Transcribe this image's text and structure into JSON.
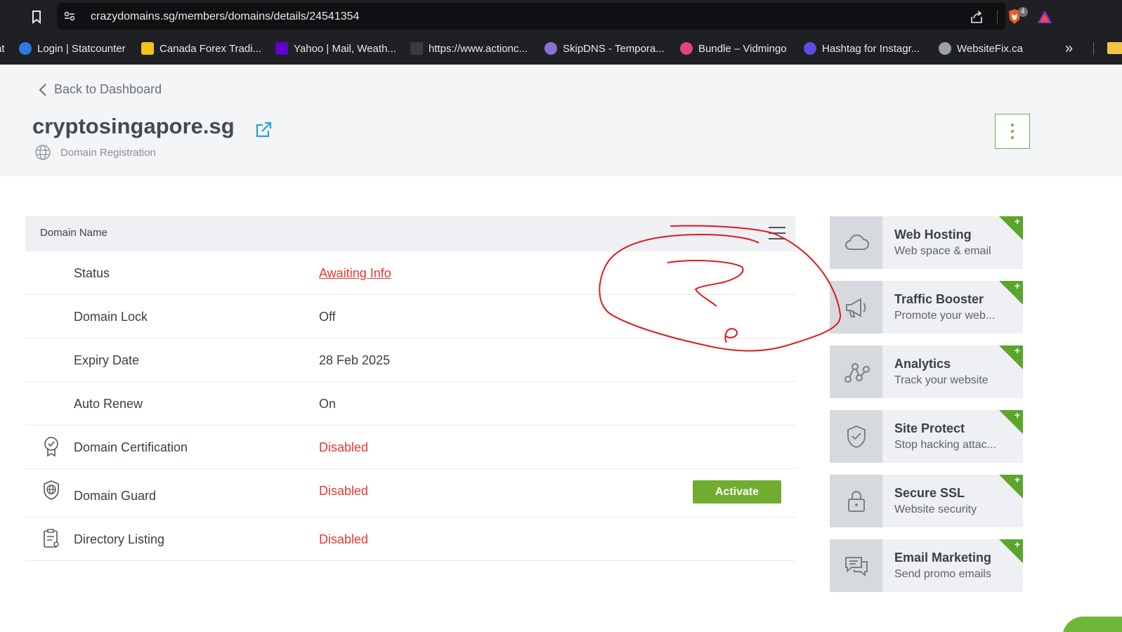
{
  "browser": {
    "url": "crazydomains.sg/members/domains/details/24541354",
    "extension_badge": "4",
    "bookmarks": [
      {
        "label": "Login | Statcounter",
        "icon": "statcounter-icon",
        "color": "#2a7ae2"
      },
      {
        "label": "Canada Forex Tradi...",
        "icon": "maple-leaf-icon",
        "color": "#f0c419"
      },
      {
        "label": "Yahoo | Mail, Weath...",
        "icon": "yahoo-icon",
        "color": "#5f01d1"
      },
      {
        "label": "https://www.actionc...",
        "icon": "page-icon",
        "color": "#3a3b3e"
      },
      {
        "label": "SkipDNS - Tempora...",
        "icon": "skipdns-icon",
        "color": "#8b6fd6"
      },
      {
        "label": "Bundle – Vidmingo",
        "icon": "bundle-icon",
        "color": "#e0457b"
      },
      {
        "label": "Hashtag for Instagr...",
        "icon": "hashtag-icon",
        "color": "#5b4ee0"
      },
      {
        "label": "WebsiteFix.ca",
        "icon": "globe-icon",
        "color": "#9aa0a6"
      }
    ]
  },
  "header": {
    "back_label": "Back to Dashboard",
    "domain": "cryptosingapore.sg",
    "domain_type": "Domain Registration"
  },
  "details": {
    "head_label": "Domain Name",
    "activate_label": "Activate",
    "rows": [
      {
        "label": "Status",
        "value": "Awaiting Info"
      },
      {
        "label": "Domain Lock",
        "value": "Off"
      },
      {
        "label": "Expiry Date",
        "value": "28 Feb 2025"
      },
      {
        "label": "Auto Renew",
        "value": "On"
      },
      {
        "label": "Domain Certification",
        "value": "Disabled",
        "icon": "certificate-icon"
      },
      {
        "label": "Domain Guard",
        "value": "Disabled",
        "icon": "shield-globe-icon"
      },
      {
        "label": "Directory Listing",
        "value": "Disabled",
        "icon": "clipboard-location-icon"
      }
    ]
  },
  "cards": [
    {
      "title": "Web Hosting",
      "sub": "Web space & email",
      "icon": "cloud-icon"
    },
    {
      "title": "Traffic Booster",
      "sub": "Promote your web...",
      "icon": "megaphone-icon"
    },
    {
      "title": "Analytics",
      "sub": "Track your website",
      "icon": "analytics-icon"
    },
    {
      "title": "Site Protect",
      "sub": "Stop hacking attac...",
      "icon": "shield-check-icon"
    },
    {
      "title": "Secure SSL",
      "sub": "Website security",
      "icon": "lock-icon"
    },
    {
      "title": "Email Marketing",
      "sub": "Send promo emails",
      "icon": "chat-icon"
    }
  ],
  "card_plus": "+",
  "colors": {
    "accent_green": "#6fac2f",
    "status_red": "#e53935",
    "annotation_red": "#e0191e"
  }
}
